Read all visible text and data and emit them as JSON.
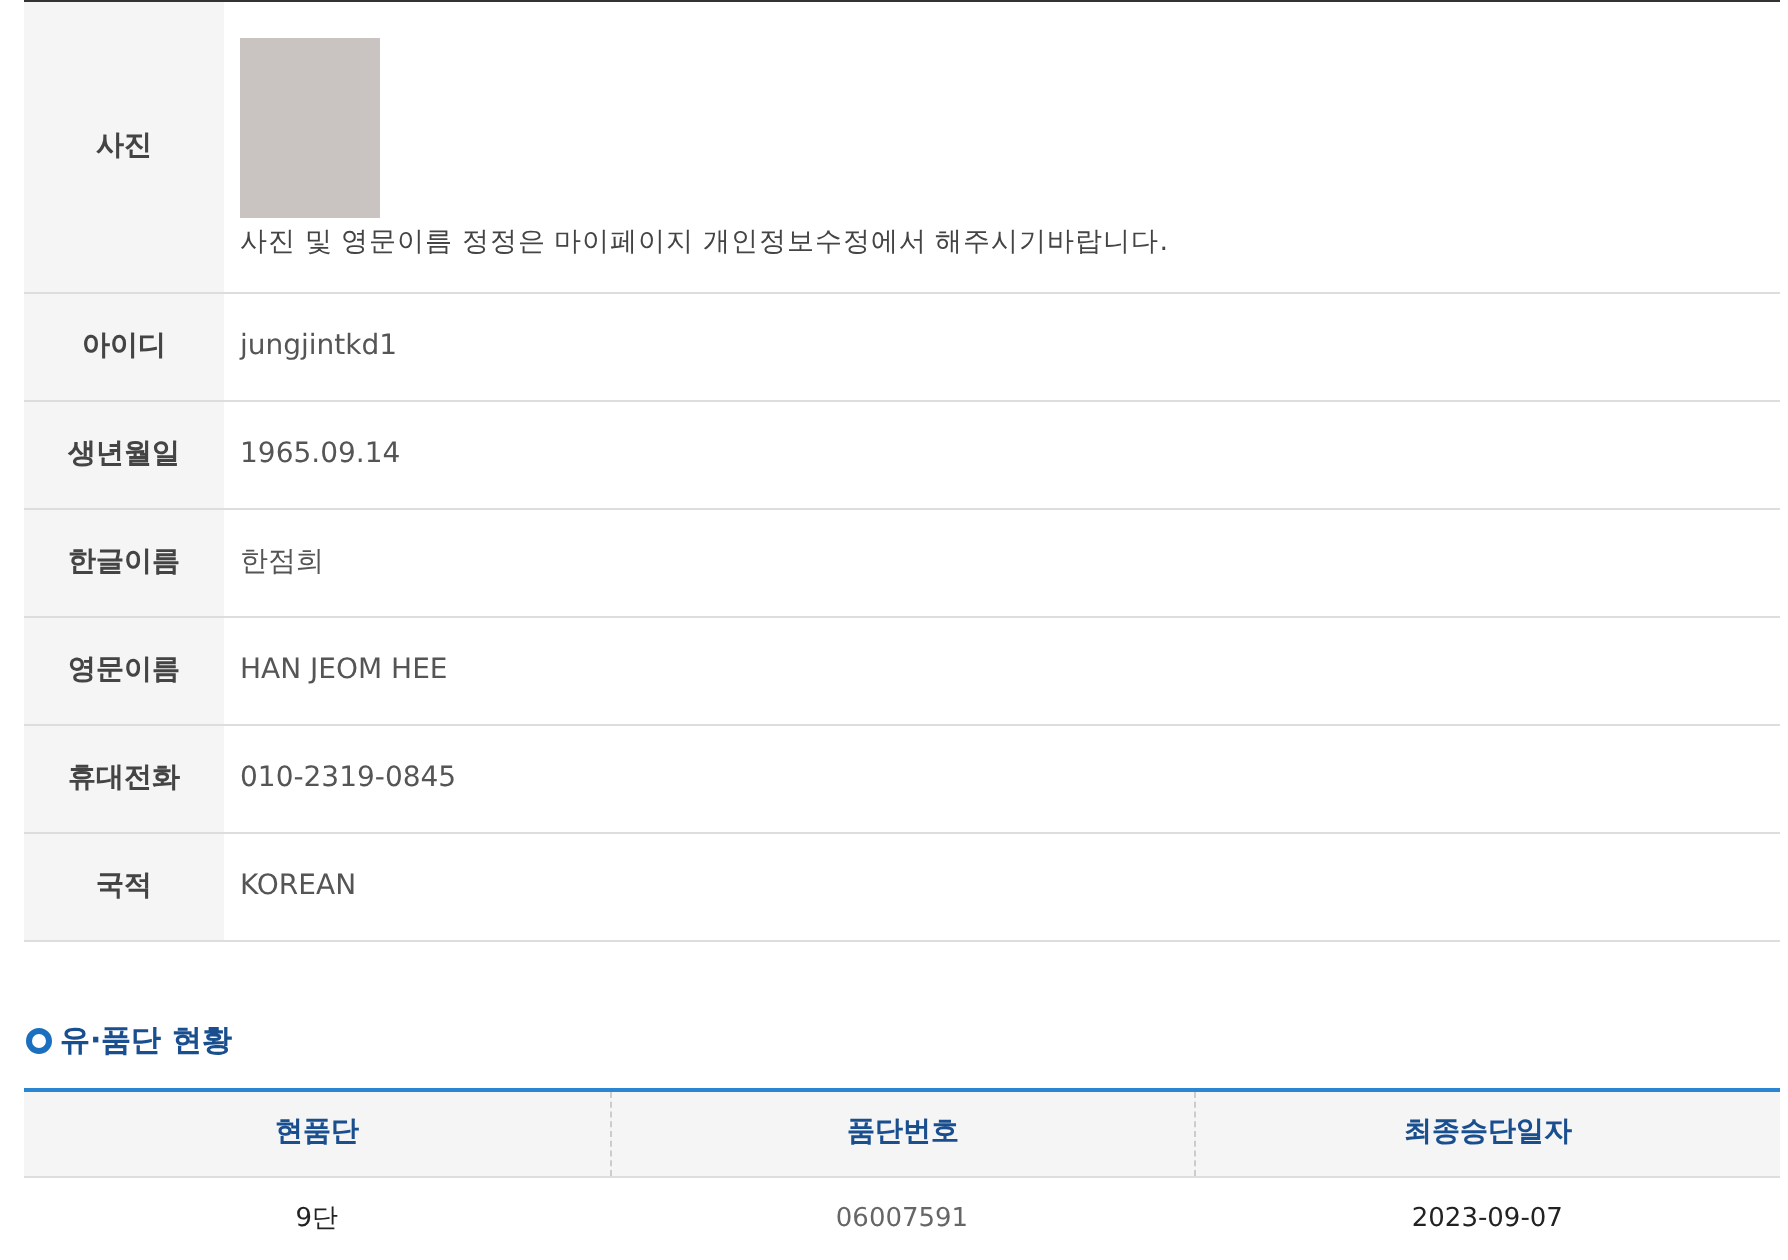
{
  "profile": {
    "rows": [
      {
        "kind": "photo",
        "label": "사진",
        "note": "사진 및 영문이름 정정은 마이페이지 개인정보수정에서 해주시기바랍니다."
      },
      {
        "kind": "text",
        "label": "아이디",
        "value": "jungjintkd1"
      },
      {
        "kind": "text",
        "label": "생년월일",
        "value": "1965.09.14"
      },
      {
        "kind": "text",
        "label": "한글이름",
        "value": "한점희"
      },
      {
        "kind": "text",
        "label": "영문이름",
        "value": "HAN JEOM HEE"
      },
      {
        "kind": "text",
        "label": "휴대전화",
        "value": "010-2319-0845"
      },
      {
        "kind": "text",
        "label": "국적",
        "value": "KOREAN"
      }
    ]
  },
  "rank_status": {
    "title": "유·품단 현황",
    "columns": [
      "현품단",
      "품단번호",
      "최종승단일자"
    ],
    "rows": [
      [
        "9단",
        "06007591",
        "2023-09-07"
      ]
    ]
  }
}
